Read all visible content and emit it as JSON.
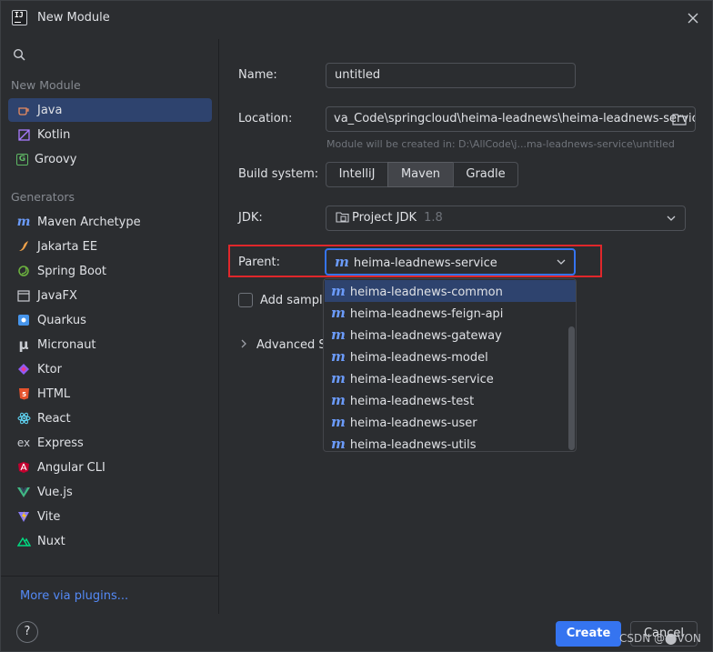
{
  "window": {
    "title": "New Module"
  },
  "sidebar": {
    "section1_label": "New Module",
    "new_module_items": [
      {
        "label": "Java",
        "icon": "java-icon",
        "selected": true
      },
      {
        "label": "Kotlin",
        "icon": "kotlin-icon"
      },
      {
        "label": "Groovy",
        "icon": "groovy-icon"
      }
    ],
    "section2_label": "Generators",
    "generator_items": [
      {
        "label": "Maven Archetype",
        "icon": "maven-icon"
      },
      {
        "label": "Jakarta EE",
        "icon": "jakarta-icon"
      },
      {
        "label": "Spring Boot",
        "icon": "spring-boot-icon"
      },
      {
        "label": "JavaFX",
        "icon": "javafx-icon"
      },
      {
        "label": "Quarkus",
        "icon": "quarkus-icon"
      },
      {
        "label": "Micronaut",
        "icon": "micronaut-icon"
      },
      {
        "label": "Ktor",
        "icon": "ktor-icon"
      },
      {
        "label": "HTML",
        "icon": "html-icon"
      },
      {
        "label": "React",
        "icon": "react-icon"
      },
      {
        "label": "Express",
        "icon": "express-icon"
      },
      {
        "label": "Angular CLI",
        "icon": "angular-icon"
      },
      {
        "label": "Vue.js",
        "icon": "vue-icon"
      },
      {
        "label": "Vite",
        "icon": "vite-icon"
      },
      {
        "label": "Nuxt",
        "icon": "nuxt-icon"
      }
    ],
    "more_plugins": "More via plugins..."
  },
  "form": {
    "name_label": "Name:",
    "name_value": "untitled",
    "location_label": "Location:",
    "location_value": "va_Code\\springcloud\\heima-leadnews\\heima-leadnews-service",
    "location_hint": "Module will be created in: D:\\AllCode\\j...ma-leadnews-service\\untitled",
    "build_label": "Build system:",
    "build_options": [
      "IntelliJ",
      "Maven",
      "Gradle"
    ],
    "build_selected": "Maven",
    "jdk_label": "JDK:",
    "jdk_value": "Project JDK",
    "jdk_version": "1.8",
    "parent_label": "Parent:",
    "parent_value": "heima-leadnews-service",
    "add_sample_label": "Add sample",
    "advanced_label": "Advanced Se"
  },
  "parent_dropdown": {
    "options": [
      "heima-leadnews-common",
      "heima-leadnews-feign-api",
      "heima-leadnews-gateway",
      "heima-leadnews-model",
      "heima-leadnews-service",
      "heima-leadnews-test",
      "heima-leadnews-user",
      "heima-leadnews-utils"
    ],
    "highlighted": "heima-leadnews-common"
  },
  "footer": {
    "help": "?",
    "create": "Create",
    "cancel": "Cancel",
    "watermark": "CSDN @⬤VON"
  },
  "colors": {
    "accent": "#3574f0",
    "selection": "#2e436e",
    "highlight_box": "#e0272b",
    "background": "#2b2d30"
  }
}
